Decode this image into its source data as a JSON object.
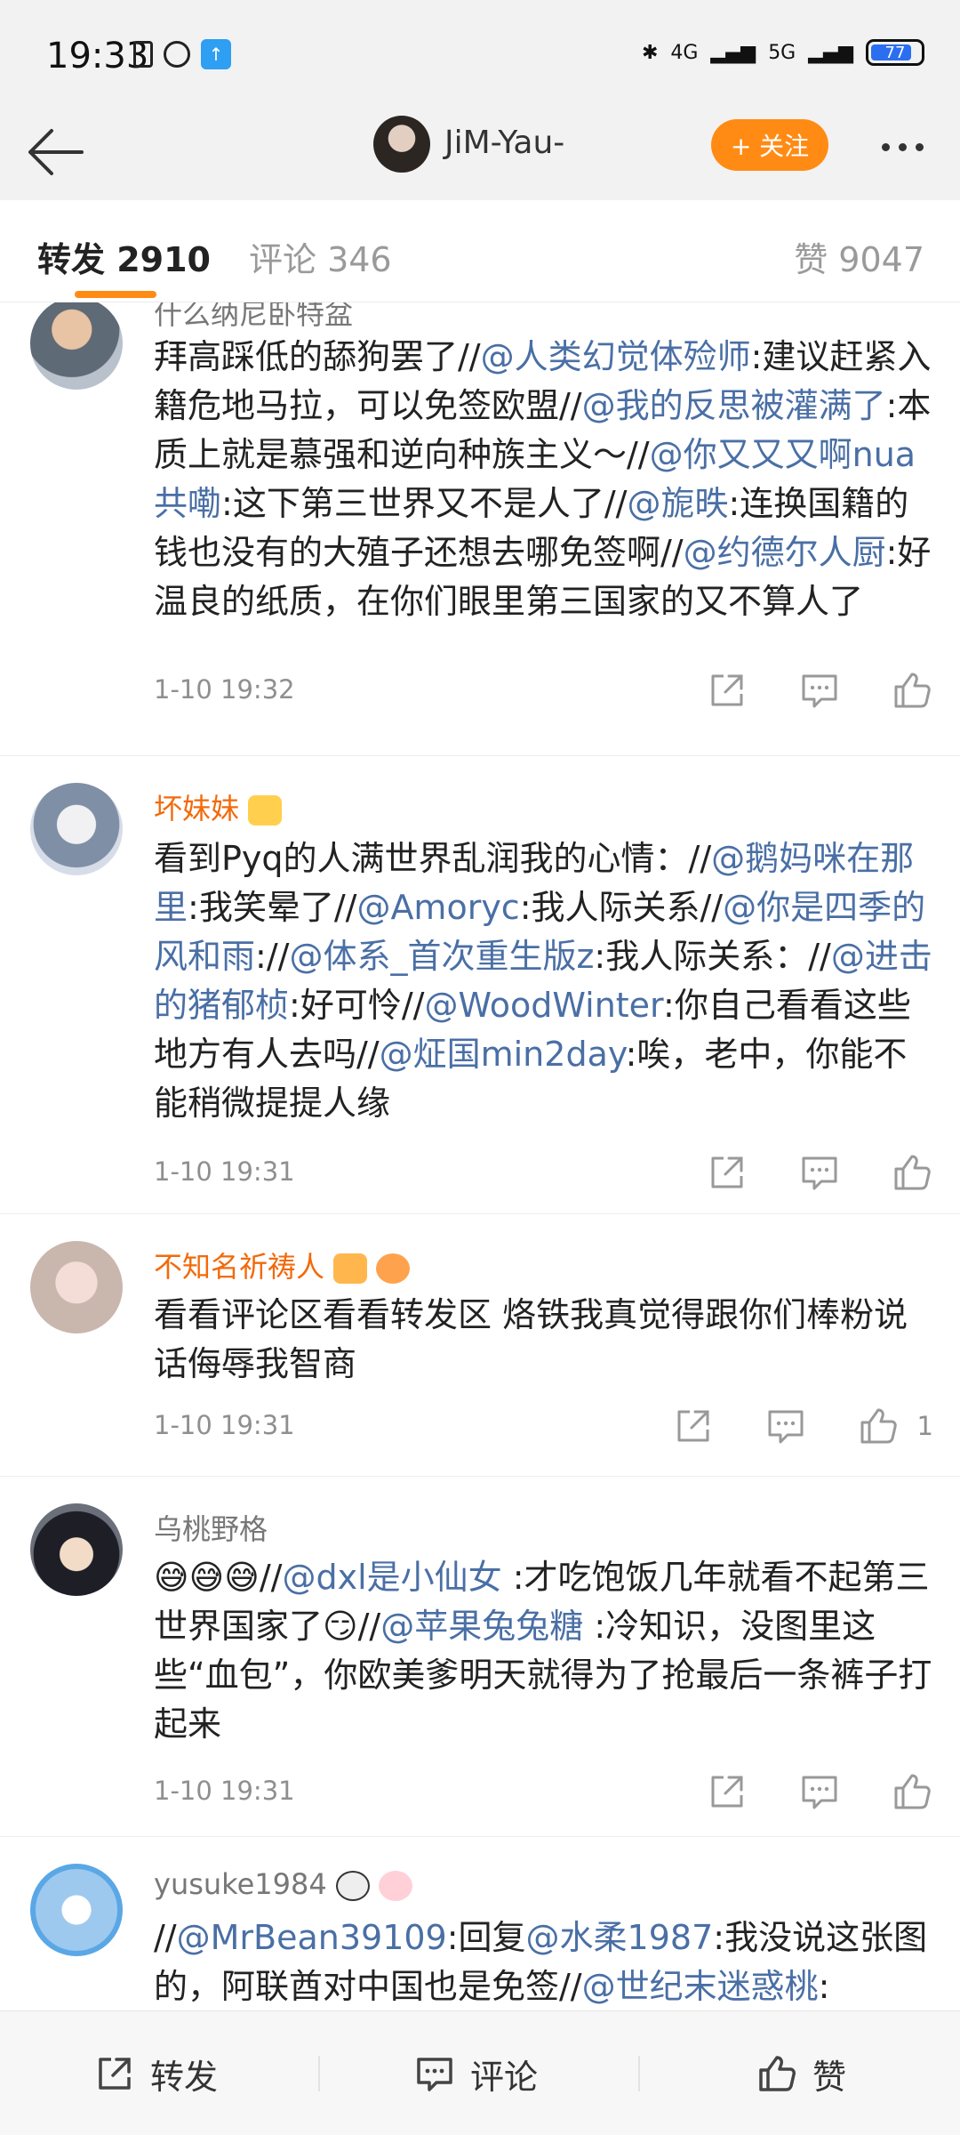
{
  "status_bar": {
    "time": "19:33",
    "network_left": "4G",
    "network_right": "5G",
    "battery": "77"
  },
  "header": {
    "username": "JiM-Yau-",
    "follow_label": "+ 关注"
  },
  "tabs": {
    "repost": "转发 2910",
    "comment": "评论 346",
    "like": "赞 9047"
  },
  "items": [
    {
      "username": "什么纳尼卧特盆",
      "text_parts": [
        {
          "t": "拜高踩低的舔狗罢了//"
        },
        {
          "t": "@人类幻觉体殓师",
          "at": true
        },
        {
          "t": ":建议赶紧入籍危地马拉，可以免签欧盟//"
        },
        {
          "t": "@我的反思被灌满了",
          "at": true
        },
        {
          "t": ":本质上就是慕强和逆向种族主义～//"
        },
        {
          "t": "@你又又又啊nua共嘞",
          "at": true
        },
        {
          "t": ":这下第三世界又不是人了//"
        },
        {
          "t": "@旎昳",
          "at": true
        },
        {
          "t": ":连换国籍的钱也没有的大殖子还想去哪免签啊//"
        },
        {
          "t": "@约德尔人厨",
          "at": true
        },
        {
          "t": ":好温良的纸质，在你们眼里第三国家的又不算人了"
        }
      ],
      "time": "1-10 19:32",
      "likes": ""
    },
    {
      "username": "坏妹妹",
      "text_parts": [
        {
          "t": "看到Pyq的人满世界乱润我的心情：//"
        },
        {
          "t": "@鹅妈咪在那里",
          "at": true
        },
        {
          "t": ":我笑晕了//"
        },
        {
          "t": "@Amoryc",
          "at": true
        },
        {
          "t": ":我人际关系//"
        },
        {
          "t": "@你是四季的风和雨",
          "at": true
        },
        {
          "t": "://"
        },
        {
          "t": "@体系_首次重生版z",
          "at": true
        },
        {
          "t": ":我人际关系：//"
        },
        {
          "t": "@进击的猪郁桢",
          "at": true
        },
        {
          "t": ":好可怜//"
        },
        {
          "t": "@WoodWinter",
          "at": true
        },
        {
          "t": ":你自己看看这些地方有人去吗//"
        },
        {
          "t": "@炡国min2day",
          "at": true
        },
        {
          "t": ":唉，老中，你能不能稍微提提人缘"
        }
      ],
      "time": "1-10 19:31",
      "likes": ""
    },
    {
      "username": "不知名祈祷人",
      "text_parts": [
        {
          "t": "看看评论区看看转发区 烙铁我真觉得跟你们棒粉说话侮辱我智商"
        }
      ],
      "time": "1-10 19:31",
      "likes": "1"
    },
    {
      "username": "乌桃野格",
      "text_parts": [
        {
          "t": "😅😅😅//"
        },
        {
          "t": "@dxl是小仙女",
          "at": true
        },
        {
          "t": " :才吃饱饭几年就看不起第三世界国家了😏//"
        },
        {
          "t": "@苹果兔兔糖",
          "at": true
        },
        {
          "t": " :冷知识，没图里这些“血包”，你欧美爹明天就得为了抢最后一条裤子打起来"
        }
      ],
      "time": "1-10 19:31",
      "likes": ""
    },
    {
      "username": "yusuke1984",
      "text_parts": [
        {
          "t": "//"
        },
        {
          "t": "@MrBean39109",
          "at": true
        },
        {
          "t": ":回复"
        },
        {
          "t": "@水柔1987",
          "at": true
        },
        {
          "t": ":我没说这张图的，阿联酋对中国也是免签//"
        },
        {
          "t": "@世纪末迷惑桃",
          "at": true
        },
        {
          "t": ":"
        }
      ],
      "time": "",
      "likes": ""
    }
  ],
  "bottom_bar": {
    "repost": "转发",
    "comment": "评论",
    "like": "赞"
  },
  "colors": {
    "accent": "#ff8b14",
    "mention": "#4a6fa5",
    "vip_name": "#f26a0a"
  },
  "icons": [
    "back-arrow-icon",
    "more-icon",
    "share-icon",
    "comment-icon",
    "like-icon"
  ]
}
